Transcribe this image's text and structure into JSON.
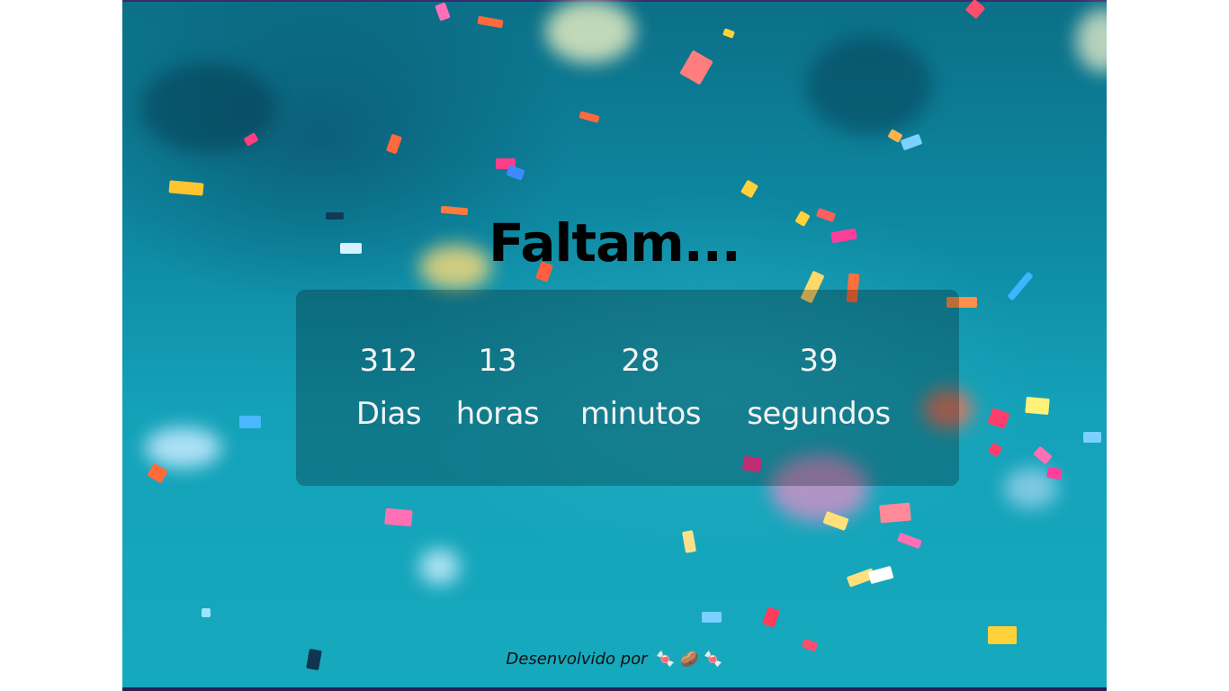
{
  "colors": {
    "background_teal": "#0e8aa3",
    "panel": "rgba(0,0,0,0.25)",
    "title": "#000000",
    "numbers": "#f3f3f3"
  },
  "countdown": {
    "title": "Faltam...",
    "units": [
      {
        "value": "312",
        "label": "Dias"
      },
      {
        "value": "13",
        "label": "horas"
      },
      {
        "value": "28",
        "label": "minutos"
      },
      {
        "value": "39",
        "label": "segundos"
      }
    ]
  },
  "footer": {
    "text": "Desenvolvido por",
    "emojis": "🍬 🥔 🍬"
  }
}
